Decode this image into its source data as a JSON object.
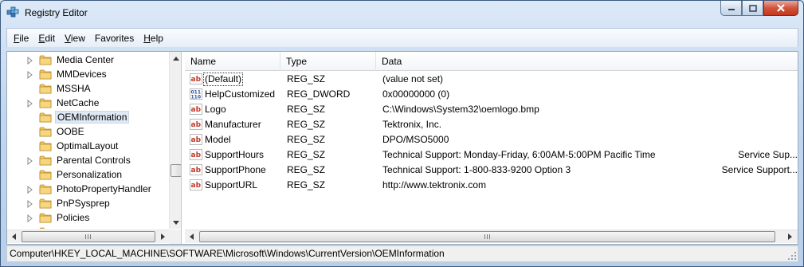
{
  "window": {
    "title": "Registry Editor",
    "icon": "registry-editor-icon"
  },
  "menu": [
    {
      "accel": "F",
      "rest": "ile"
    },
    {
      "accel": "E",
      "rest": "dit"
    },
    {
      "accel": "V",
      "rest": "iew"
    },
    {
      "accel": "",
      "rest": "Favorites"
    },
    {
      "accel": "H",
      "rest": "elp"
    }
  ],
  "tree": {
    "items": [
      {
        "label": "Media Center",
        "expandable": true
      },
      {
        "label": "MMDevices",
        "expandable": true
      },
      {
        "label": "MSSHA",
        "expandable": false
      },
      {
        "label": "NetCache",
        "expandable": true
      },
      {
        "label": "OEMInformation",
        "expandable": false,
        "selected": true
      },
      {
        "label": "OOBE",
        "expandable": false
      },
      {
        "label": "OptimalLayout",
        "expandable": false
      },
      {
        "label": "Parental Controls",
        "expandable": true
      },
      {
        "label": "Personalization",
        "expandable": false
      },
      {
        "label": "PhotoPropertyHandler",
        "expandable": true
      },
      {
        "label": "PnPSysprep",
        "expandable": true
      },
      {
        "label": "Policies",
        "expandable": true
      }
    ]
  },
  "list": {
    "columns": {
      "name": "Name",
      "type": "Type",
      "data": "Data"
    },
    "rows": [
      {
        "icon": "string-value-icon",
        "name": "(Default)",
        "type": "REG_SZ",
        "data": "(value not set)",
        "extra": "",
        "focused": true
      },
      {
        "icon": "dword-value-icon",
        "name": "HelpCustomized",
        "type": "REG_DWORD",
        "data": "0x00000000 (0)",
        "extra": ""
      },
      {
        "icon": "string-value-icon",
        "name": "Logo",
        "type": "REG_SZ",
        "data": "C:\\Windows\\System32\\oemlogo.bmp",
        "extra": ""
      },
      {
        "icon": "string-value-icon",
        "name": "Manufacturer",
        "type": "REG_SZ",
        "data": "Tektronix, Inc.",
        "extra": ""
      },
      {
        "icon": "string-value-icon",
        "name": "Model",
        "type": "REG_SZ",
        "data": "DPO/MSO5000",
        "extra": ""
      },
      {
        "icon": "string-value-icon",
        "name": "SupportHours",
        "type": "REG_SZ",
        "data": "Technical Support:   Monday-Friday, 6:00AM-5:00PM Pacific Time",
        "extra": "Service Sup..."
      },
      {
        "icon": "string-value-icon",
        "name": "SupportPhone",
        "type": "REG_SZ",
        "data": "Technical Support:   1-800-833-9200 Option 3",
        "extra": "Service Support..."
      },
      {
        "icon": "string-value-icon",
        "name": "SupportURL",
        "type": "REG_SZ",
        "data": "http://www.tektronix.com",
        "extra": ""
      }
    ]
  },
  "status": {
    "path": "Computer\\HKEY_LOCAL_MACHINE\\SOFTWARE\\Microsoft\\Windows\\CurrentVersion\\OEMInformation"
  },
  "colors": {
    "title_gradient": "#c3d7ee",
    "close_button": "#c0381e",
    "selection": "#dfe9f5",
    "folder": "#f1c75a"
  }
}
